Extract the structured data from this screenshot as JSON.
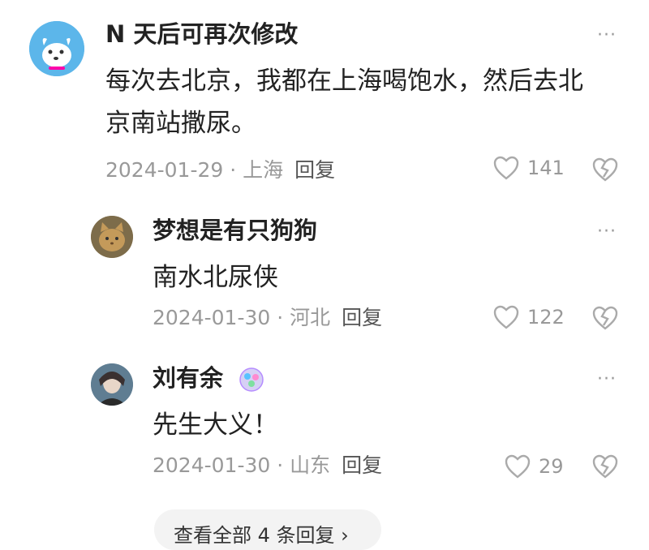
{
  "comments": [
    {
      "user": "N 天后可再次修改",
      "content_line1": "每次去北京，我都在上海喝饱水，然后去北",
      "content_line2": "京南站撒尿。",
      "date": "2024-01-29",
      "location": "上海",
      "reply_label": "回复",
      "likes": "141",
      "more": "···"
    },
    {
      "user": "梦想是有只狗狗",
      "content": "南水北尿侠",
      "date": "2024-01-30",
      "location": "河北",
      "reply_label": "回复",
      "likes": "122",
      "more": "···"
    },
    {
      "user": "刘有余",
      "content": "先生大义！",
      "date": "2024-01-30",
      "location": "山东",
      "reply_label": "回复",
      "likes": "29",
      "more": "···"
    }
  ],
  "view_more": "查看全部 4 条回复 ›",
  "colors": {
    "text": "#222222",
    "meta": "#999999",
    "icon": "#aaaaaa"
  }
}
